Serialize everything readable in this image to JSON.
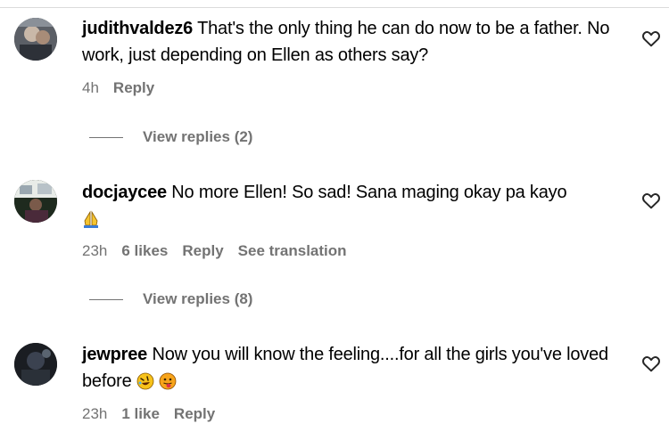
{
  "comments": [
    {
      "username": "judithvaldez6",
      "text": "That's the only thing he can do now to be a father. No work, just depending on Ellen as others say?",
      "time": "4h",
      "likes": "",
      "reply_label": "Reply",
      "translation_label": "",
      "view_replies": "View replies (2)",
      "avatar_icon": "user-avatar",
      "like_icon": "heart-outline-icon"
    },
    {
      "username": "docjaycee",
      "text": "No more Ellen! So sad! Sana maging okay pa kayo",
      "emoji": [
        "folded-hands-emoji"
      ],
      "time": "23h",
      "likes": "6 likes",
      "reply_label": "Reply",
      "translation_label": "See translation",
      "view_replies": "View replies (8)",
      "avatar_icon": "user-avatar",
      "like_icon": "heart-outline-icon"
    },
    {
      "username": "jewpree",
      "text": "Now you will know the feeling....for all the girls you've loved before",
      "emoji": [
        "rolling-on-floor-laughing-emoji",
        "face-with-tongue-emoji"
      ],
      "time": "23h",
      "likes": "1 like",
      "reply_label": "Reply",
      "translation_label": "",
      "view_replies": "",
      "avatar_icon": "user-avatar",
      "like_icon": "heart-outline-icon"
    }
  ],
  "colors": {
    "text": "#000000",
    "secondary": "#737373",
    "divider": "#dbdbdb",
    "background": "#ffffff"
  }
}
